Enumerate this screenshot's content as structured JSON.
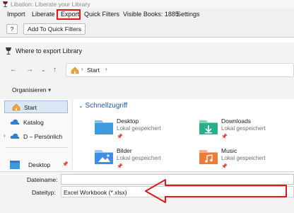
{
  "app": {
    "window_title": "Libation: Liberate your Library",
    "menu": [
      "Import",
      "Liberate",
      "Export",
      "Quick Filters",
      "Visible Books: 1885",
      "Settings"
    ],
    "help_button": "?",
    "add_quick_filters_button": "Add To Quick Filters"
  },
  "dialog": {
    "title": "Where to export Library",
    "breadcrumb": [
      "Start"
    ],
    "organize_label": "Organisieren",
    "sidebar": [
      {
        "label": "Start",
        "icon": "home-icon",
        "selected": true
      },
      {
        "label": "Katalog",
        "icon": "cloud-icon",
        "selected": false
      },
      {
        "label": "D – Persönlich",
        "icon": "cloud-icon",
        "selected": false
      },
      {
        "label": "Desktop",
        "icon": "desktop-icon",
        "selected": false
      }
    ],
    "section_title": "Schnellzugriff",
    "quick_access": [
      {
        "name": "Desktop",
        "subtitle": "Lokal gespeichert",
        "icon": "desktop-folder-icon",
        "color": "#3b9bdc"
      },
      {
        "name": "Downloads",
        "subtitle": "Lokal gespeichert",
        "icon": "downloads-folder-icon",
        "color": "#2bae8a"
      },
      {
        "name": "Bilder",
        "subtitle": "Lokal gespeichert",
        "icon": "pictures-folder-icon",
        "color": "#3c8ee8"
      },
      {
        "name": "Music",
        "subtitle": "Lokal gespeichert",
        "icon": "music-folder-icon",
        "color": "#f07a3a"
      }
    ],
    "filename_label": "Dateiname:",
    "filename_value": "",
    "filetype_label": "Dateityp:",
    "filetype_value": "Excel Workbook (*.xlsx)"
  },
  "colors": {
    "highlight": "#e01818",
    "link": "#1f57a8"
  }
}
